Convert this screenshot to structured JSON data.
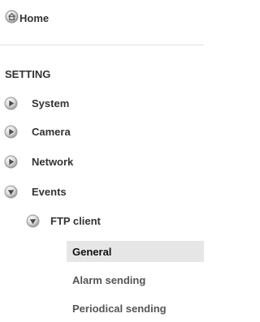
{
  "home": {
    "label": "Home",
    "icon": "home-icon"
  },
  "section_heading": "SETTING",
  "nav": {
    "system": {
      "label": "System",
      "icon": "arrow-right-icon"
    },
    "camera": {
      "label": "Camera",
      "icon": "arrow-right-icon"
    },
    "network": {
      "label": "Network",
      "icon": "arrow-right-icon"
    },
    "events": {
      "label": "Events",
      "icon": "arrow-down-icon"
    },
    "ftp_client": {
      "label": "FTP client",
      "icon": "arrow-down-icon"
    }
  },
  "sub_items": {
    "general": {
      "label": "General",
      "selected": true
    },
    "alarm_sending": {
      "label": "Alarm sending",
      "selected": false
    },
    "periodical_sending": {
      "label": "Periodical sending",
      "selected": false
    }
  },
  "colors": {
    "text": "#333333",
    "selected_bg": "#e6e6e6",
    "divider": "#e2e2e2",
    "icon_gray": "#8a8a8a"
  }
}
